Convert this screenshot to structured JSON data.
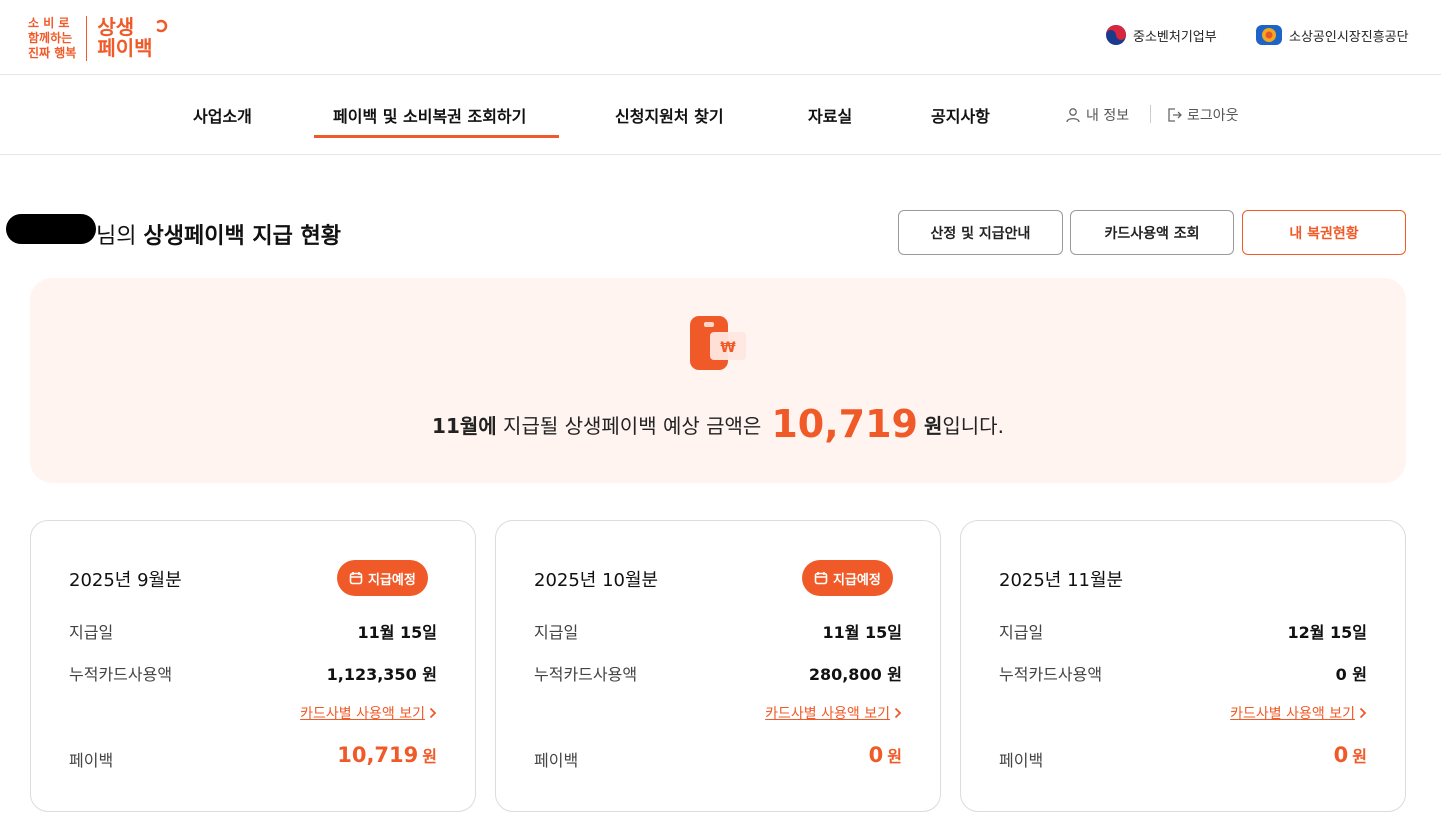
{
  "header": {
    "slogan_lines": [
      "소 비 로",
      "함께하는",
      "진짜 행복"
    ],
    "brand_lines": [
      "상생",
      "페이백"
    ],
    "orgs": [
      "중소벤처기업부",
      "소상공인시장진흥공단"
    ]
  },
  "nav": {
    "items": [
      "사업소개",
      "페이백 및 소비복권 조회하기",
      "신청지원처 찾기",
      "자료실",
      "공지사항"
    ],
    "active_index": 1,
    "my_info": "내 정보",
    "logout": "로그아웃"
  },
  "title": {
    "prefix": "님의",
    "main": "상생페이백 지급 현황"
  },
  "buttons": [
    "산정 및 지급안내",
    "카드사용액 조회",
    "내 복권현황"
  ],
  "summary": {
    "month": "11월에",
    "text_before": "지급될 상생페이백 예상 금액은",
    "amount": "10,719",
    "unit": "원",
    "text_after": "입니다."
  },
  "cards": [
    {
      "period": "2025년 9월분",
      "badge": "지급예정",
      "pay_date_label": "지급일",
      "pay_date": "11월 15일",
      "usage_label": "누적카드사용액",
      "usage": "1,123,350 원",
      "link": "카드사별 사용액 보기",
      "payback_label": "페이백",
      "payback": "10,719",
      "payback_unit": "원"
    },
    {
      "period": "2025년 10월분",
      "badge": "지급예정",
      "pay_date_label": "지급일",
      "pay_date": "11월 15일",
      "usage_label": "누적카드사용액",
      "usage": "280,800 원",
      "link": "카드사별 사용액 보기",
      "payback_label": "페이백",
      "payback": "0",
      "payback_unit": "원"
    },
    {
      "period": "2025년 11월분",
      "badge": "",
      "pay_date_label": "지급일",
      "pay_date": "12월 15일",
      "usage_label": "누적카드사용액",
      "usage": "0 원",
      "link": "카드사별 사용액 보기",
      "payback_label": "페이백",
      "payback": "0",
      "payback_unit": "원"
    }
  ],
  "colors": {
    "accent": "#f05a28",
    "banner_bg": "#fff4f0",
    "border": "#dcdcdc"
  }
}
